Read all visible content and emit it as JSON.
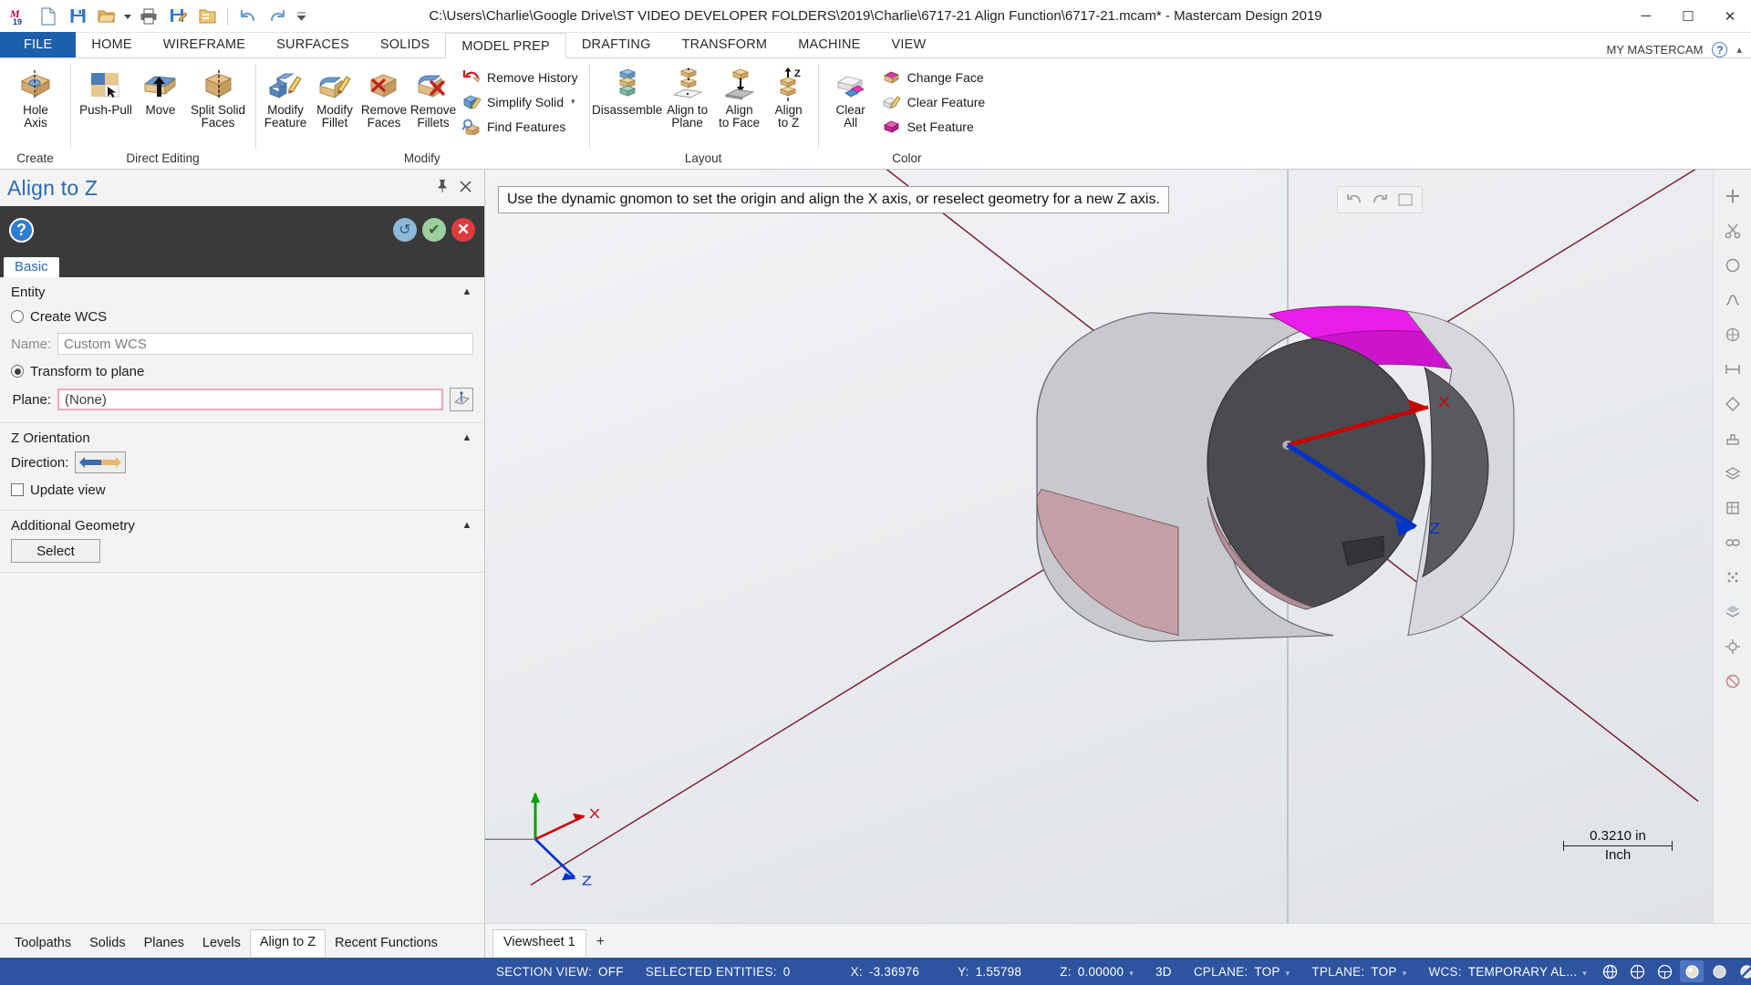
{
  "titlebar": {
    "title": "C:\\Users\\Charlie\\Google Drive\\ST VIDEO DEVELOPER FOLDERS\\2019\\Charlie\\6717-21 Align Function\\6717-21.mcam* - Mastercam Design 2019",
    "quick_access": [
      {
        "name": "mastercam-logo-icon",
        "label": "Mastercam 19"
      },
      {
        "name": "new-file-icon",
        "label": "New"
      },
      {
        "name": "save-icon",
        "label": "Save"
      },
      {
        "name": "open-folder-icon",
        "label": "Open"
      },
      {
        "name": "open-dropdown-caret",
        "label": "▾"
      },
      {
        "name": "print-icon",
        "label": "Print"
      },
      {
        "name": "save-as-icon",
        "label": "Save As"
      },
      {
        "name": "folder-icon",
        "label": "Folder"
      },
      {
        "name": "undo-icon",
        "label": "Undo"
      },
      {
        "name": "redo-icon",
        "label": "Redo"
      },
      {
        "name": "customize-qat-caret",
        "label": "▾"
      }
    ],
    "window_buttons": {
      "minimize": "─",
      "maximize": "☐",
      "close": "✕"
    }
  },
  "ribbon": {
    "tabs": [
      {
        "label": "FILE",
        "active": false,
        "is_file": true
      },
      {
        "label": "HOME",
        "active": false
      },
      {
        "label": "WIREFRAME",
        "active": false
      },
      {
        "label": "SURFACES",
        "active": false
      },
      {
        "label": "SOLIDS",
        "active": false
      },
      {
        "label": "MODEL PREP",
        "active": true
      },
      {
        "label": "DRAFTING",
        "active": false
      },
      {
        "label": "TRANSFORM",
        "active": false
      },
      {
        "label": "MACHINE",
        "active": false
      },
      {
        "label": "VIEW",
        "active": false
      }
    ],
    "account_label": "MY MASTERCAM",
    "help_label": "?",
    "collapse_label": "▴",
    "groups": [
      {
        "title": "Create",
        "big_buttons": [
          {
            "label": "Hole\nAxis",
            "icon": "hole-axis-icon",
            "line1": "Hole",
            "line2": "Axis"
          }
        ]
      },
      {
        "title": "Direct Editing",
        "big_buttons": [
          {
            "icon": "push-pull-icon",
            "line1": "Push-Pull",
            "line2": ""
          },
          {
            "icon": "move-icon",
            "line1": "Move",
            "line2": ""
          },
          {
            "icon": "split-solid-faces-icon",
            "line1": "Split Solid",
            "line2": "Faces"
          }
        ]
      },
      {
        "title": "Modify",
        "big_buttons": [
          {
            "icon": "modify-feature-icon",
            "line1": "Modify",
            "line2": "Feature"
          },
          {
            "icon": "modify-fillet-icon",
            "line1": "Modify",
            "line2": "Fillet"
          },
          {
            "icon": "remove-faces-icon",
            "line1": "Remove",
            "line2": "Faces"
          },
          {
            "icon": "remove-fillets-icon",
            "line1": "Remove",
            "line2": "Fillets"
          }
        ],
        "small_buttons": [
          {
            "label": "Remove History",
            "icon": "remove-history-icon",
            "caret": false
          },
          {
            "label": "Simplify Solid",
            "icon": "simplify-solid-icon",
            "caret": true
          },
          {
            "label": "Find Features",
            "icon": "find-features-icon",
            "caret": false
          }
        ]
      },
      {
        "title": "Layout",
        "big_buttons": [
          {
            "icon": "disassemble-icon",
            "line1": "Disassemble",
            "line2": ""
          },
          {
            "icon": "align-to-plane-icon",
            "line1": "Align to",
            "line2": "Plane"
          },
          {
            "icon": "align-to-face-icon",
            "line1": "Align",
            "line2": "to Face"
          },
          {
            "icon": "align-to-z-icon",
            "line1": "Align",
            "line2": "to Z"
          }
        ]
      },
      {
        "title": "Color",
        "big_buttons": [
          {
            "icon": "clear-all-icon",
            "line1": "Clear",
            "line2": "All"
          }
        ],
        "small_buttons": [
          {
            "label": "Change Face",
            "icon": "change-face-icon",
            "caret": false
          },
          {
            "label": "Clear Feature",
            "icon": "clear-feature-icon",
            "caret": false
          },
          {
            "label": "Set Feature",
            "icon": "set-feature-icon",
            "caret": false
          }
        ]
      }
    ]
  },
  "panel": {
    "title": "Align to Z",
    "pin_icon": "pin-icon",
    "close_icon": "close-icon",
    "help_icon": "help-icon",
    "actions": [
      {
        "name": "reset-button",
        "glyph": "↺"
      },
      {
        "name": "apply-button",
        "glyph": "✔"
      },
      {
        "name": "cancel-button",
        "glyph": "✕"
      }
    ],
    "tab": "Basic",
    "sections": [
      {
        "title": "Entity",
        "collapse_glyph": "▲",
        "create_wcs_label": "Create WCS",
        "create_wcs_selected": false,
        "name_label": "Name:",
        "name_value": "Custom WCS",
        "transform_label": "Transform to plane",
        "transform_selected": true,
        "plane_label": "Plane:",
        "plane_value": "(None)",
        "plane_picker_icon": "plane-selector-icon"
      },
      {
        "title": "Z Orientation",
        "collapse_glyph": "▲",
        "direction_label": "Direction:",
        "direction_icon": "flip-direction-icon",
        "update_view_label": "Update view",
        "update_view_checked": false
      },
      {
        "title": "Additional Geometry",
        "collapse_glyph": "▲",
        "select_button_label": "Select"
      }
    ],
    "bottom_tabs": [
      {
        "label": "Toolpaths",
        "active": false
      },
      {
        "label": "Solids",
        "active": false
      },
      {
        "label": "Planes",
        "active": false
      },
      {
        "label": "Levels",
        "active": false
      },
      {
        "label": "Align to Z",
        "active": true
      },
      {
        "label": "Recent Functions",
        "active": false
      }
    ]
  },
  "viewport": {
    "tooltip": "Use the dynamic gnomon to set the origin and align the X axis, or reselect geometry for a new Z axis.",
    "scale_value": "0.3210 in",
    "scale_unit": "Inch",
    "gnomon_axes": [
      {
        "label": "X",
        "color": "#cc0000"
      },
      {
        "label": "Y",
        "color": "#00a000"
      },
      {
        "label": "Z",
        "color": "#0033cc"
      }
    ],
    "dynamic_gnomon_axes": [
      {
        "label": "X",
        "color": "#cc0000"
      },
      {
        "label": "Z",
        "color": "#0033cc"
      }
    ],
    "overlay_tools": [
      "undo-view-icon",
      "redo-view-icon",
      "fit-view-icon"
    ],
    "right_tools": [
      "add-icon",
      "scissors-icon",
      "circle-icon",
      "curve-icon",
      "grid-icon",
      "measure-icon",
      "tag-icon",
      "stamp-icon",
      "layers-icon",
      "box-icon",
      "chain-icon",
      "dots-icon",
      "stack-icon",
      "gear-icon",
      "block-icon"
    ],
    "viewsheets": [
      {
        "label": "Viewsheet 1",
        "active": true
      }
    ],
    "add_viewsheet_label": "+"
  },
  "statusbar": {
    "items": [
      {
        "name": "section-view-status",
        "caption": "SECTION VIEW:",
        "value": "OFF",
        "caret": false
      },
      {
        "name": "selected-entities-status",
        "caption": "SELECTED ENTITIES:",
        "value": "0",
        "caret": false
      },
      {
        "name": "x-coordinate",
        "caption": "X:",
        "value": "-3.36976",
        "caret": false
      },
      {
        "name": "y-coordinate",
        "caption": "Y:",
        "value": "1.55798",
        "caret": false
      },
      {
        "name": "z-coordinate",
        "caption": "Z:",
        "value": "0.00000",
        "caret": true
      },
      {
        "name": "view-mode",
        "caption": "",
        "value": "3D",
        "caret": false
      },
      {
        "name": "cplane-status",
        "caption": "CPLANE:",
        "value": "TOP",
        "caret": true
      },
      {
        "name": "tplane-status",
        "caption": "TPLANE:",
        "value": "TOP",
        "caret": true
      },
      {
        "name": "wcs-status",
        "caption": "WCS:",
        "value": "TEMPORARY AL...",
        "caret": true
      }
    ],
    "icons": [
      {
        "name": "wireframe-shading-icon",
        "selected": false
      },
      {
        "name": "hidden-line-icon",
        "selected": false
      },
      {
        "name": "no-hidden-icon",
        "selected": false
      },
      {
        "name": "shaded-icon",
        "selected": true
      },
      {
        "name": "shaded-solid-icon",
        "selected": false
      },
      {
        "name": "translucent-icon",
        "selected": false
      },
      {
        "name": "resize-grip-icon",
        "selected": false
      }
    ],
    "scroll_arrows": [
      "◂",
      "▸"
    ]
  },
  "colors": {
    "accent_blue": "#2a6ab0",
    "file_tab_blue": "#1d5faa",
    "status_blue": "#2e54a0",
    "panel_dark": "#3a3a3a",
    "magenta_face": "#e81ee8",
    "axis_red": "#cc0000",
    "axis_blue": "#0033cc",
    "axis_green": "#00a000",
    "pink_field_border": "#f0a8b8"
  }
}
